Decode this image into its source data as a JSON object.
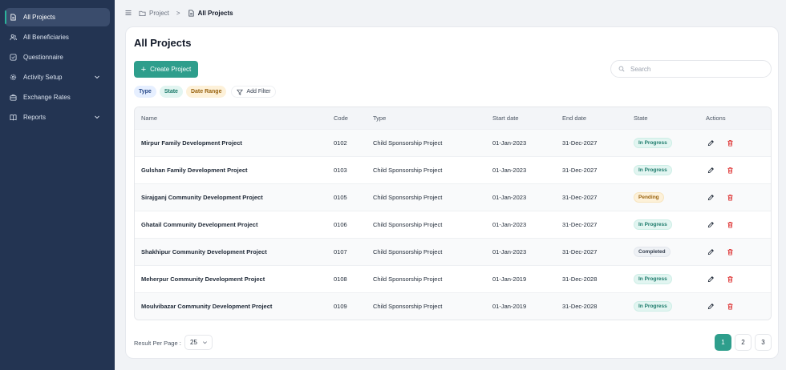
{
  "sidebar": {
    "items": [
      {
        "label": "All Projects",
        "icon": "file-icon"
      },
      {
        "label": "All Beneficiaries",
        "icon": "users-icon"
      },
      {
        "label": "Questionnaire",
        "icon": "checkbox-icon"
      },
      {
        "label": "Activity Setup",
        "icon": "gear-icon"
      },
      {
        "label": "Exchange Rates",
        "icon": "briefcase-icon"
      },
      {
        "label": "Reports",
        "icon": "book-icon"
      }
    ]
  },
  "breadcrumb": {
    "parent": "Project",
    "separator": ">",
    "current": "All Projects"
  },
  "main": {
    "title": "All Projects",
    "create_label": "Create Project",
    "search_placeholder": "Search",
    "filters": {
      "type": "Type",
      "state": "State",
      "date_range": "Date Range",
      "add": "Add Filter"
    },
    "columns": [
      "Name",
      "Code",
      "Type",
      "Start date",
      "End date",
      "State",
      "Actions"
    ],
    "rows": [
      {
        "name": "Mirpur Family Development Project",
        "code": "0102",
        "type": "Child Sponsorship Project",
        "start": "01-Jan-2023",
        "end": "31-Dec-2027",
        "state": "In Progress"
      },
      {
        "name": "Gulshan Family Development Project",
        "code": "0103",
        "type": "Child Sponsorship Project",
        "start": "01-Jan-2023",
        "end": "31-Dec-2027",
        "state": "In Progress"
      },
      {
        "name": "Sirajganj Community Development Project",
        "code": "0105",
        "type": "Child Sponsorship Project",
        "start": "01-Jan-2023",
        "end": "31-Dec-2027",
        "state": "Pending"
      },
      {
        "name": "Ghatail Community Development Project",
        "code": "0106",
        "type": "Child Sponsorship Project",
        "start": "01-Jan-2023",
        "end": "31-Dec-2027",
        "state": "In Progress"
      },
      {
        "name": "Shakhipur Community Development Project",
        "code": "0107",
        "type": "Child Sponsorship Project",
        "start": "01-Jan-2023",
        "end": "31-Dec-2027",
        "state": "Completed"
      },
      {
        "name": "Meherpur Community Development Project",
        "code": "0108",
        "type": "Child Sponsorship Project",
        "start": "01-Jan-2019",
        "end": "31-Dec-2028",
        "state": "In Progress"
      },
      {
        "name": "Moulvibazar Community Development Project",
        "code": "0109",
        "type": "Child Sponsorship Project",
        "start": "01-Jan-2019",
        "end": "31-Dec-2028",
        "state": "In Progress"
      }
    ],
    "footer": {
      "per_page_label": "Result Per Page :",
      "per_page_value": "25",
      "pages": [
        "1",
        "2",
        "3"
      ],
      "active_page": "1"
    }
  },
  "colors": {
    "sidebar": "#233452",
    "accent": "#2e9e8c",
    "delete": "#dc2626"
  }
}
